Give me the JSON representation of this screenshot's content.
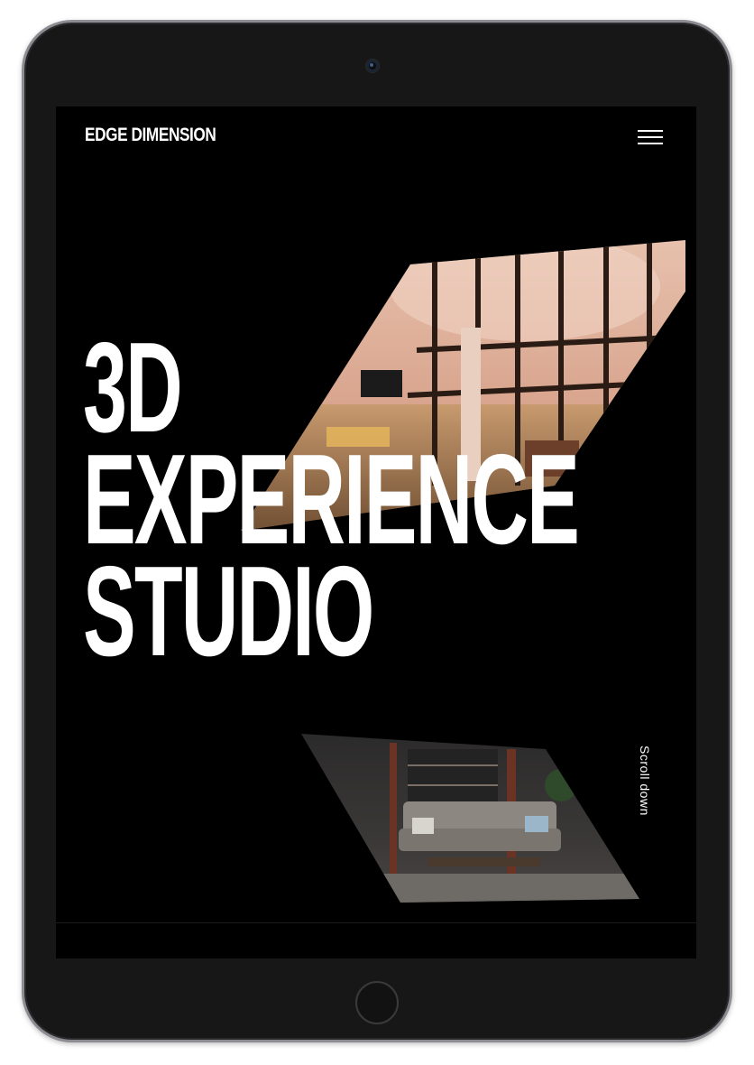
{
  "header": {
    "brand": "EDGE DIMENSION",
    "menu_icon": "hamburger-menu-icon"
  },
  "hero": {
    "title_lines": [
      "3D",
      "EXPERIENCE",
      "STUDIO"
    ],
    "images": [
      "interior-loft-image",
      "living-room-image"
    ]
  },
  "scroll_hint": {
    "label": "Scroll down"
  },
  "colors": {
    "background": "#000000",
    "text": "#ffffff",
    "device_frame": "#171717",
    "device_bezel": "#8c8c92"
  }
}
